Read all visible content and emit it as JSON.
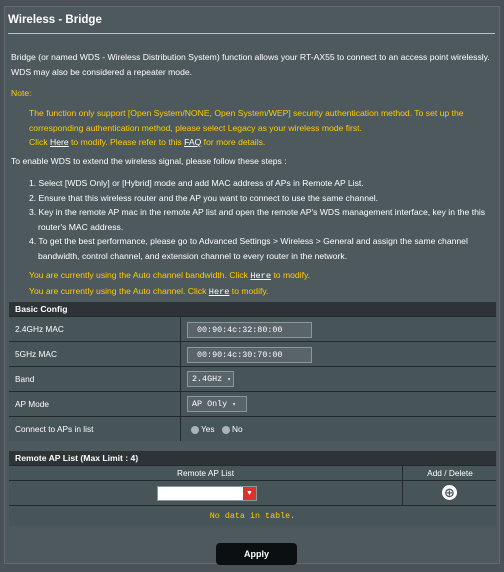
{
  "page": {
    "title": "Wireless - Bridge",
    "intro_line1": "Bridge (or named WDS - Wireless Distribution System) function allows your RT-AX55 to connect to an access point wirelessly.",
    "intro_line2": "WDS may also be considered a repeater mode."
  },
  "note": {
    "label": "Note:",
    "line1": "The function only support [Open System/NONE, Open System/WEP] security authentication method. To set up the",
    "line2": "corresponding authentication method, please select Legacy as your wireless mode first.",
    "line3_pre": "Click ",
    "line3_link": "Here",
    "line3_mid": " to modify. Please refer to this ",
    "line3_faq": "FAQ",
    "line3_post": " for more details."
  },
  "steps_intro": "To enable WDS to extend the wireless signal, please follow these steps :",
  "steps": [
    "1. Select [WDS Only] or [Hybrid] mode and add MAC address of APs in Remote AP List.",
    "2. Ensure that this wireless router and the AP you want to connect to use the same channel.",
    "3. Key in the remote AP mac in the remote AP list and open the remote AP's WDS management interface, key in the this",
    "router's MAC address.",
    "4. To get the best performance, please go to Advanced Settings > Wireless > General and assign the same channel",
    "bandwidth, control channel, and extension channel to every router in the network."
  ],
  "auto_notes": {
    "bw_pre": "You are currently using the Auto channel bandwidth. Click ",
    "bw_link": "Here",
    "bw_post": " to modify.",
    "ch_pre": "You are currently using the Auto channel. Click ",
    "ch_link": "Here",
    "ch_post": " to modify."
  },
  "basic_config": {
    "header": "Basic Config",
    "mac24_label": "2.4GHz MAC",
    "mac24_value": "00:90:4c:32:80:00",
    "mac5_label": "5GHz MAC",
    "mac5_value": "00:90:4c:30:70:00",
    "band_label": "Band",
    "band_value": "2.4GHz",
    "ap_mode_label": "AP Mode",
    "ap_mode_value": "AP Only",
    "connect_label": "Connect to APs in list",
    "connect_yes": "Yes",
    "connect_no": "No"
  },
  "remote_list": {
    "header": "Remote AP List (Max Limit : 4)",
    "col_list": "Remote AP List",
    "col_add": "Add / Delete",
    "add_icon": "⊕",
    "empty_text": "No data in table."
  },
  "apply_label": "Apply"
}
